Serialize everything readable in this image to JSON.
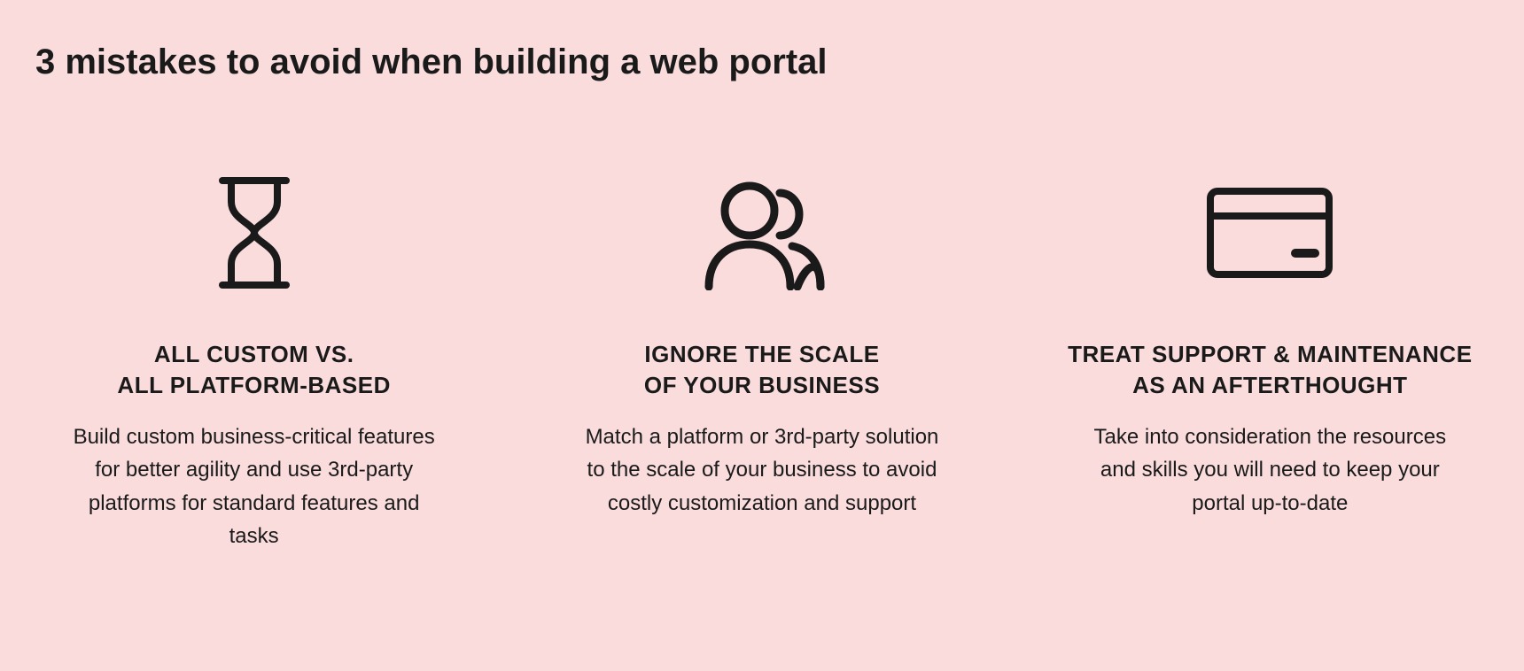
{
  "title": "3 mistakes to avoid when building a web portal",
  "columns": [
    {
      "icon": "hourglass-icon",
      "heading": "ALL CUSTOM VS.\nALL PLATFORM-BASED",
      "body": "Build custom business-critical features for better agility and use 3rd-party platforms for standard features and tasks"
    },
    {
      "icon": "people-icon",
      "heading": "IGNORE THE SCALE\nOF YOUR BUSINESS",
      "body": "Match a platform or 3rd-party solution to the scale of your business to avoid costly customization and support"
    },
    {
      "icon": "card-icon",
      "heading": "TREAT SUPPORT & MAINTENANCE\nAS AN AFTERTHOUGHT",
      "body": "Take into consideration the resources and skills you will need to keep your portal up-to-date"
    }
  ]
}
